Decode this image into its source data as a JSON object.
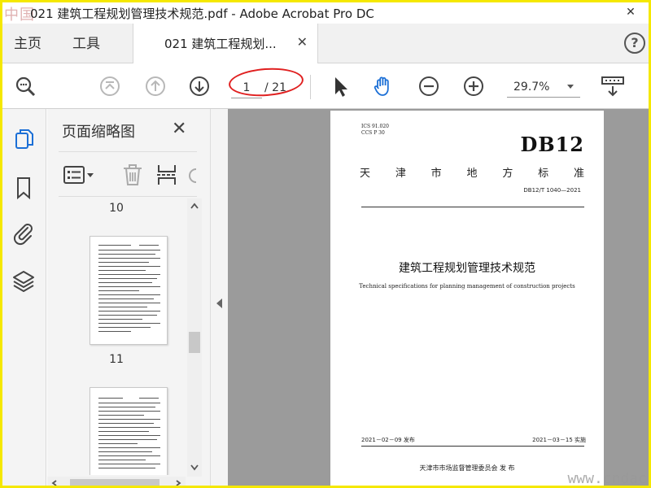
{
  "watermark_top": "中国",
  "window_title": "021 建筑工程规划管理技术规范.pdf - Adobe Acrobat Pro DC",
  "window_close": "✕",
  "tabs": {
    "home": "主页",
    "tools": "工具",
    "doc_tab": "021 建筑工程规划...",
    "doc_close": "✕"
  },
  "help": "?",
  "toolbar": {
    "page_current": "1",
    "page_total": "/ 21",
    "zoom": "29.7%"
  },
  "panel": {
    "title": "页面缩略图",
    "close": "✕"
  },
  "thumbnails": [
    {
      "number": "10"
    },
    {
      "number": "11"
    }
  ],
  "page": {
    "ics": "ICS  91.020",
    "ccs": "CCS  P 30",
    "code": "DB12",
    "standard_chars": [
      "天",
      "津",
      "市",
      "地",
      "方",
      "标",
      "准"
    ],
    "standard_no": "DB12/T 1040—2021",
    "title_cn": "建筑工程规划管理技术规范",
    "title_en": "Technical specifications for planning management of construction projects",
    "issue_date": "2021－02－09 发布",
    "effective_date": "2021－03－15 实施",
    "issuer": "天津市市场监督管理委员会    发 布"
  },
  "watermark_bottom": "www.cndac",
  "colors": {
    "accent_blue": "#1b6fd6",
    "highlight_red": "#e02020",
    "frame_yellow": "#f5e800"
  }
}
